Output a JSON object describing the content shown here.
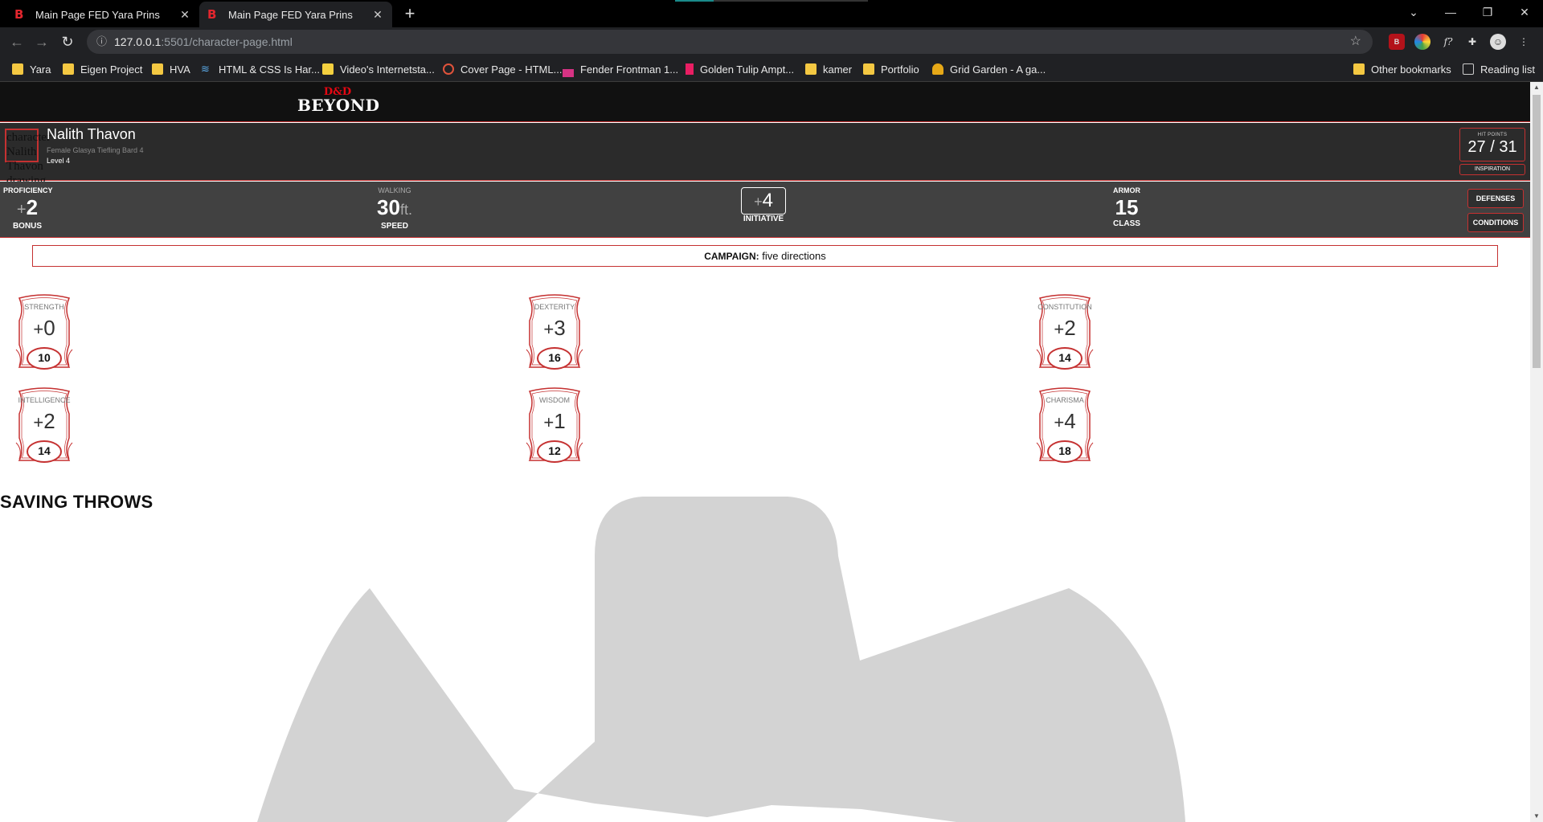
{
  "browser": {
    "tabs": [
      {
        "title": "Main Page FED Yara Prins",
        "favicon": "B"
      },
      {
        "title": "Main Page FED Yara Prins",
        "favicon": "B"
      }
    ],
    "url_host": "127.0.0.1",
    "url_rest": ":5501/character-page.html",
    "bookmarks": [
      {
        "label": "Yara",
        "icon": "folder-icon"
      },
      {
        "label": "Eigen Project",
        "icon": "folder-icon"
      },
      {
        "label": "HVA",
        "icon": "folder-icon"
      },
      {
        "label": "HTML & CSS Is Har...",
        "icon": "wifi-icon"
      },
      {
        "label": "Video's Internetsta...",
        "icon": "video-icon"
      },
      {
        "label": "Cover Page - HTML...",
        "icon": "codepen-icon"
      },
      {
        "label": "Fender Frontman 1...",
        "icon": "bars-icon"
      },
      {
        "label": "Golden Tulip Ampt...",
        "icon": "flag-icon"
      },
      {
        "label": "kamer",
        "icon": "folder-icon"
      },
      {
        "label": "Portfolio",
        "icon": "folder-icon"
      },
      {
        "label": "Grid Garden - A ga...",
        "icon": "carrot-icon"
      }
    ],
    "other_bookmarks": "Other bookmarks",
    "reading_list": "Reading list"
  },
  "site": {
    "logo_top": "D&D",
    "logo_bottom": "BEYOND"
  },
  "character": {
    "avatar_alt": "character Nalith Thavon drawing",
    "name": "Nalith Thavon",
    "subtitle": "Female Glasya Tiefling Bard 4",
    "level": "Level 4",
    "hp_label": "HIT POINTS",
    "hp_value": "27 / 31",
    "inspiration": "INSPIRATION"
  },
  "stats": {
    "proficiency": {
      "top": "PROFICIENCY",
      "sign": "+",
      "value": "2",
      "bottom": "BONUS"
    },
    "speed": {
      "top": "WALKING",
      "value": "30",
      "unit": "ft.",
      "bottom": "SPEED"
    },
    "initiative": {
      "sign": "+",
      "value": "4",
      "bottom": "INITIATIVE"
    },
    "armor": {
      "top": "ARMOR",
      "value": "15",
      "bottom": "CLASS"
    },
    "defenses": "DEFENSES",
    "conditions": "CONDITIONS"
  },
  "campaign": {
    "label": "CAMPAIGN:",
    "value": "five directions"
  },
  "abilities": [
    {
      "name": "STRENGTH",
      "sign": "+",
      "mod": "0",
      "score": "10"
    },
    {
      "name": "DEXTERITY",
      "sign": "+",
      "mod": "3",
      "score": "16"
    },
    {
      "name": "CONSTITUTION",
      "sign": "+",
      "mod": "2",
      "score": "14"
    },
    {
      "name": "INTELLIGENCE",
      "sign": "+",
      "mod": "2",
      "score": "14"
    },
    {
      "name": "WISDOM",
      "sign": "+",
      "mod": "1",
      "score": "12"
    },
    {
      "name": "CHARISMA",
      "sign": "+",
      "mod": "4",
      "score": "18"
    }
  ],
  "saving_throws_title": "SAVING THROWS",
  "colors": {
    "accent": "#c53131",
    "header_bg": "#111111",
    "bar_bg": "#414141",
    "browser_bg": "#202124"
  }
}
